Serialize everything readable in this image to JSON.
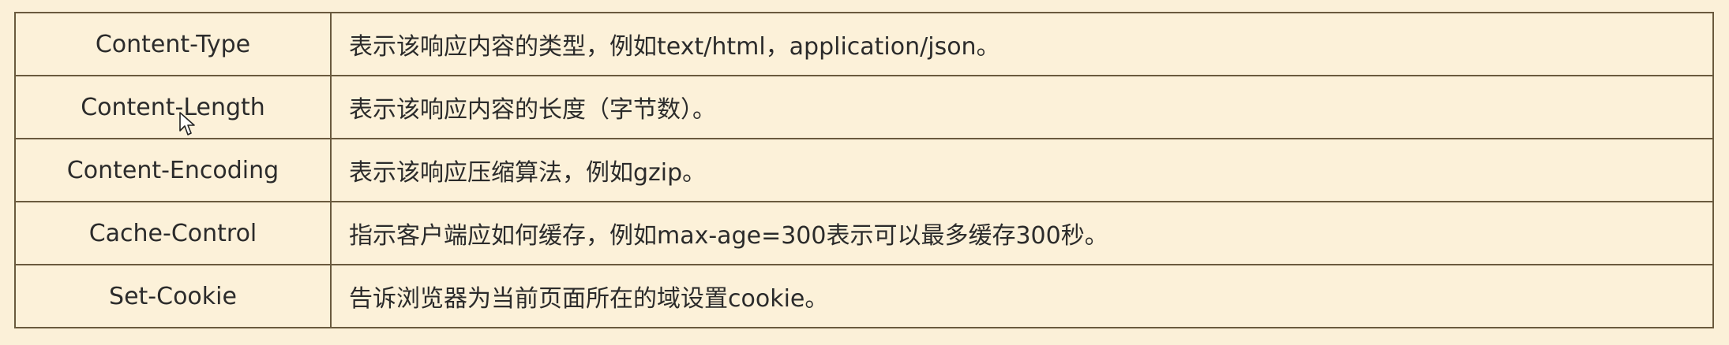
{
  "table": {
    "rows": [
      {
        "name": "Content-Type",
        "description": "表示该响应内容的类型，例如text/html，application/json。"
      },
      {
        "name": "Content-Length",
        "description": "表示该响应内容的长度（字节数）。"
      },
      {
        "name": "Content-Encoding",
        "description": "表示该响应压缩算法，例如gzip。"
      },
      {
        "name": "Cache-Control",
        "description": "指示客户端应如何缓存，例如max-age=300表示可以最多缓存300秒。"
      },
      {
        "name": "Set-Cookie",
        "description": "告诉浏览器为当前页面所在的域设置cookie。"
      }
    ]
  },
  "colors": {
    "background": "#fbf0d8",
    "border": "#6a5a3e",
    "text": "#2b2b2b"
  },
  "icons": {
    "cursor": "mouse-pointer-icon"
  }
}
